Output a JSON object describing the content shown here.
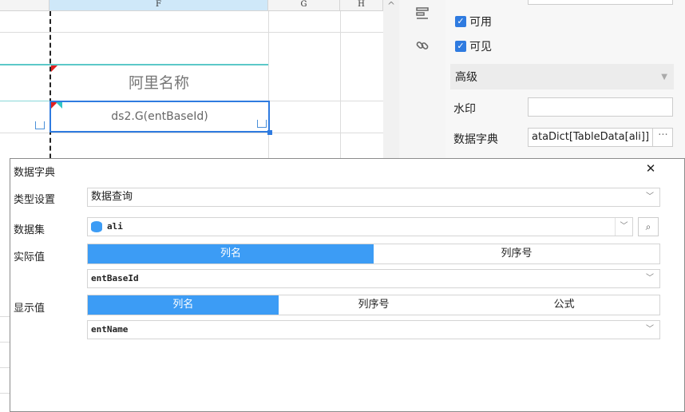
{
  "sheet": {
    "columns": [
      "F",
      "G",
      "H"
    ],
    "ali_cell": "阿里名称",
    "selected_cell": "ds2.G(entBaseId)"
  },
  "props": {
    "enabled_label": "可用",
    "visible_label": "可见",
    "advanced_section": "高级",
    "watermark_label": "水印",
    "watermark_value": "",
    "dict_label": "数据字典",
    "dict_value": "ataDict[TableData[ali]]",
    "more_glyph": "···"
  },
  "dialog": {
    "title": "数据字典",
    "type_label": "类型设置",
    "type_value": "数据查询",
    "dataset_label": "数据集",
    "dataset_value": "ali",
    "actual_label": "实际值",
    "actual_tabs": [
      "列名",
      "列序号"
    ],
    "actual_active": 0,
    "actual_value": "entBaseId",
    "display_label": "显示值",
    "display_tabs": [
      "列名",
      "列序号",
      "公式"
    ],
    "display_active": 0,
    "display_value": "entName"
  },
  "icons": {
    "close": "close-icon",
    "dropdown": "chevron-down-icon",
    "database": "database-icon",
    "preview": "preview-icon",
    "check": "checkbox-checked-icon",
    "link": "link-icon",
    "align": "align-icon"
  },
  "colors": {
    "accent": "#3c9cf5",
    "selection": "#2f7be0",
    "teal_line": "#5cc8c8"
  }
}
